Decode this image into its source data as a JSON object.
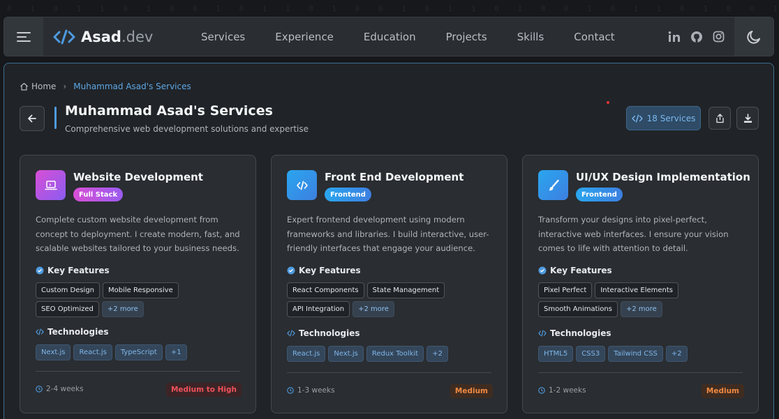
{
  "navbar": {
    "brand_name": "Asad",
    "brand_tld": ".dev",
    "links": [
      "Services",
      "Experience",
      "Education",
      "Projects",
      "Skills",
      "Contact"
    ],
    "social_icons": [
      "linkedin-icon",
      "github-icon",
      "instagram-icon"
    ]
  },
  "breadcrumb": {
    "home": "Home",
    "current": "Muhammad Asad's Services"
  },
  "header": {
    "title": "Muhammad Asad's Services",
    "subtitle": "Comprehensive web development solutions and expertise",
    "services_count_label": "18 Services"
  },
  "labels": {
    "key_features": "Key Features",
    "technologies": "Technologies"
  },
  "cards": [
    {
      "title": "Website Development",
      "category": "Full Stack",
      "icon": "laptop-icon",
      "description": "Complete custom website development from concept to deployment. I create modern, fast, and scalable websites tailored to your business needs.",
      "features": [
        "Custom Design",
        "Mobile Responsive",
        "SEO Optimized"
      ],
      "features_more": "+2 more",
      "technologies": [
        "Next.js",
        "React.js",
        "TypeScript"
      ],
      "tech_more": "+1",
      "duration": "2-4 weeks",
      "complexity": "Medium to High"
    },
    {
      "title": "Front End Development",
      "category": "Frontend",
      "icon": "code-icon",
      "description": "Expert frontend development using modern frameworks and libraries. I build interactive, user-friendly interfaces that engage your audience.",
      "features": [
        "React Components",
        "State Management",
        "API Integration"
      ],
      "features_more": "+2 more",
      "technologies": [
        "React.js",
        "Next.js",
        "Redux Toolkit"
      ],
      "tech_more": "+2",
      "duration": "1-3 weeks",
      "complexity": "Medium"
    },
    {
      "title": "UI/UX Design Implementation",
      "category": "Frontend",
      "icon": "brush-icon",
      "description": "Transform your designs into pixel-perfect, interactive web interfaces. I ensure your vision comes to life with attention to detail.",
      "features": [
        "Pixel Perfect",
        "Interactive Elements",
        "Smooth Animations"
      ],
      "features_more": "+2 more",
      "technologies": [
        "HTML5",
        "CSS3",
        "Tailwind CSS"
      ],
      "tech_more": "+2",
      "duration": "1-2 weeks",
      "complexity": "Medium"
    }
  ],
  "colors": {
    "accent": "#4f9be0",
    "card1_icon_gradient": [
      "#d84fd6",
      "#8a5cf0"
    ],
    "card_frontend_gradient": [
      "#2aa6ef",
      "#3d7fe0"
    ],
    "complexity_high": "#f0525c",
    "complexity_medium": "#f08a42"
  }
}
